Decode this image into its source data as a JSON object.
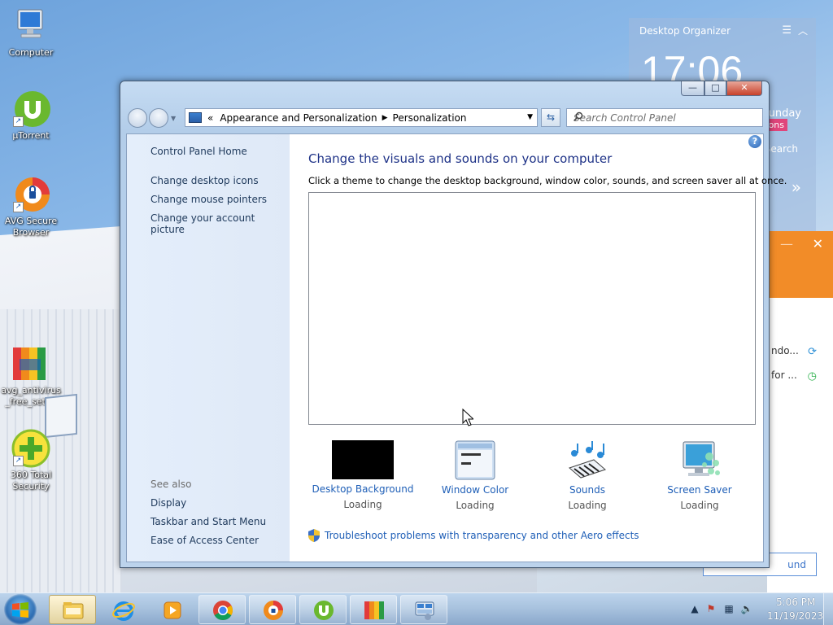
{
  "desktop": {
    "icons": [
      {
        "label": "Computer",
        "name": "computer"
      },
      {
        "label": "µTorrent",
        "name": "utorrent"
      },
      {
        "label": "AVG Secure Browser",
        "name": "avg-secure-browser"
      },
      {
        "label": "avg_antivirus _free_setup",
        "name": "avg-antivirus-setup"
      },
      {
        "label": "360 Total Security",
        "name": "360-total-security"
      }
    ]
  },
  "organizer": {
    "title": "Desktop Organizer",
    "time": "17:06",
    "day": "unday",
    "badge": "ons",
    "search": "Search"
  },
  "avg_panel": {
    "row1": "ndo...",
    "row2": "for ...",
    "button": "und"
  },
  "window": {
    "caption_buttons": {
      "minimize": "—",
      "maximize": "□",
      "close": "✕"
    },
    "address": {
      "chevron": "«",
      "crumb1": "Appearance and Personalization",
      "sep": "▶",
      "crumb2": "Personalization"
    },
    "search_placeholder": "Search Control Panel",
    "sidebar": {
      "home": "Control Panel Home",
      "links": [
        "Change desktop icons",
        "Change mouse pointers",
        "Change your account picture"
      ],
      "see_also": "See also",
      "see_also_links": [
        "Display",
        "Taskbar and Start Menu",
        "Ease of Access Center"
      ]
    },
    "main": {
      "heading": "Change the visuals and sounds on your computer",
      "subtitle": "Click a theme to change the desktop background, window color, sounds, and screen saver all at once.",
      "tiles": [
        {
          "label": "Desktop Background",
          "status": "Loading"
        },
        {
          "label": "Window Color",
          "status": "Loading"
        },
        {
          "label": "Sounds",
          "status": "Loading"
        },
        {
          "label": "Screen Saver",
          "status": "Loading"
        }
      ],
      "troubleshoot": "Troubleshoot problems with transparency and other Aero effects"
    }
  },
  "taskbar": {
    "apps": [
      "windows-explorer",
      "internet-explorer",
      "media-player",
      "chrome",
      "avg-browser",
      "utorrent",
      "avg-antivirus",
      "control-panel"
    ],
    "time": "5:06 PM",
    "date": "11/19/2023"
  }
}
